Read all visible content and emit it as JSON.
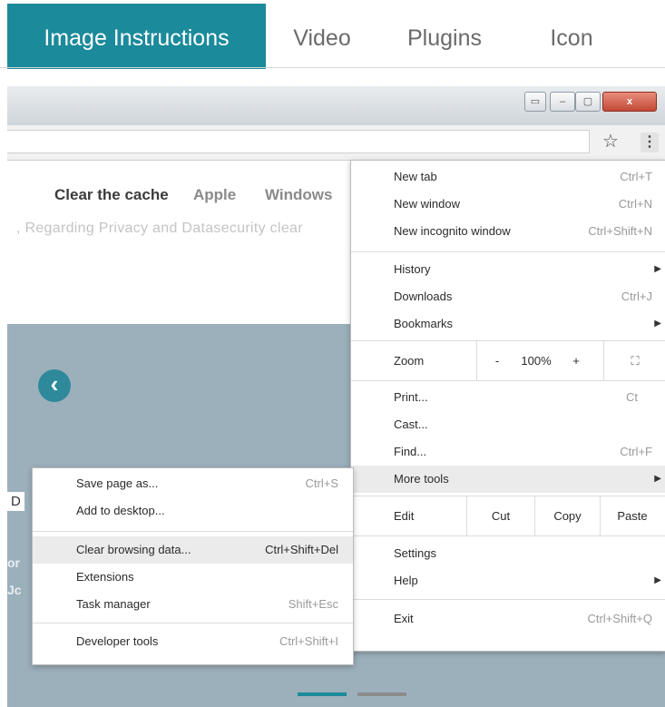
{
  "tabs": [
    {
      "label": "Image Instructions",
      "active": true
    },
    {
      "label": "Video"
    },
    {
      "label": "Plugins"
    },
    {
      "label": "Icon"
    }
  ],
  "browser": {
    "window_buttons": [
      "▭",
      "–",
      "▢",
      "x"
    ],
    "star_icon": "☆",
    "kebab_icon": "⋮"
  },
  "page": {
    "nav_active": "Clear the cache",
    "nav_items": [
      "Apple",
      "Windows"
    ],
    "faded_text": ", Regarding Privacy and Datasecurity clear",
    "behind_letter": "D",
    "behind_bold_1": "or",
    "behind_bold_2": "Jc",
    "prev_icon": "‹",
    "next_icon": "›"
  },
  "menu": {
    "new_tab": {
      "label": "New tab",
      "shortcut": "Ctrl+T"
    },
    "new_window": {
      "label": "New window",
      "shortcut": "Ctrl+N"
    },
    "new_incognito": {
      "label": "New incognito window",
      "shortcut": "Ctrl+Shift+N"
    },
    "history": {
      "label": "History",
      "arrow": "▶"
    },
    "downloads": {
      "label": "Downloads",
      "shortcut": "Ctrl+J"
    },
    "bookmarks": {
      "label": "Bookmarks",
      "arrow": "▶"
    },
    "zoom": {
      "label": "Zoom",
      "minus": "-",
      "value": "100%",
      "plus": "+",
      "fullscreen_icon": "⛶"
    },
    "print": {
      "label": "Print...",
      "shortcut": "Ct"
    },
    "cast": {
      "label": "Cast..."
    },
    "find": {
      "label": "Find...",
      "shortcut": "Ctrl+F"
    },
    "more_tools": {
      "label": "More tools",
      "arrow": "▶"
    },
    "edit": {
      "label": "Edit",
      "cut": "Cut",
      "copy": "Copy",
      "paste": "Paste"
    },
    "settings": {
      "label": "Settings"
    },
    "help": {
      "label": "Help",
      "arrow": "▶"
    },
    "exit": {
      "label": "Exit",
      "shortcut": "Ctrl+Shift+Q"
    }
  },
  "submenu": {
    "save_page": {
      "label": "Save page as...",
      "shortcut": "Ctrl+S"
    },
    "add_desktop": {
      "label": "Add to desktop..."
    },
    "clear_data": {
      "label": "Clear browsing data...",
      "shortcut": "Ctrl+Shift+Del"
    },
    "extensions": {
      "label": "Extensions"
    },
    "task_manager": {
      "label": "Task manager",
      "shortcut": "Shift+Esc"
    },
    "dev_tools": {
      "label": "Developer tools",
      "shortcut": "Ctrl+Shift+I"
    }
  },
  "slider": {
    "slide_count": 2,
    "active_index": 0
  },
  "colors": {
    "accent": "#1b8a9b",
    "arrow": "#2e8a9a",
    "backdrop": "#9cb0bc"
  }
}
